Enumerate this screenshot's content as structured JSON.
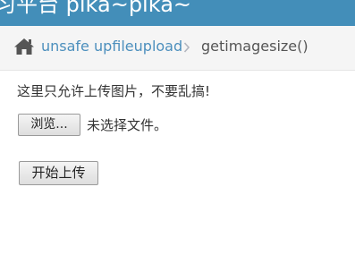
{
  "header": {
    "site_title": "习平台 pika~pika~"
  },
  "breadcrumb": {
    "home_icon": "home-icon",
    "section_label": "unsafe upfileupload",
    "separator_icon": "chevron-right-icon",
    "current_label": "getimagesize()"
  },
  "main": {
    "notice": "这里只允许上传图片，不要乱搞!",
    "file_input": {
      "browse_label": "浏览...",
      "status": "未选择文件。"
    },
    "submit_label": "开始上传"
  },
  "colors": {
    "topbar": "#438eb9",
    "link": "#4c8fbd",
    "breadcrumb_bg": "#f5f5f5"
  }
}
